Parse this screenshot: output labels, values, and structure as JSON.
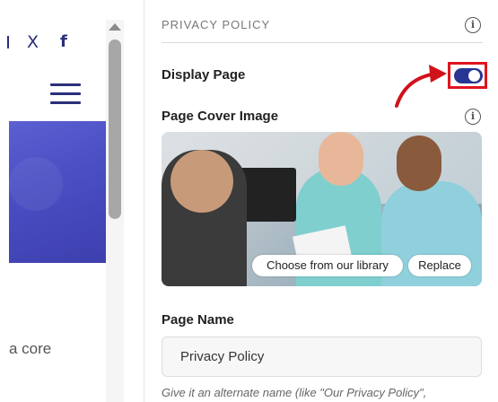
{
  "preview": {
    "social": {
      "x_icon": "X",
      "f_icon": "f"
    },
    "hamburger_icon": "menu-icon",
    "body_text": "a core"
  },
  "panel": {
    "section_title": "PRIVACY POLICY",
    "display_page_label": "Display Page",
    "display_page_enabled": true,
    "cover_image_label": "Page Cover Image",
    "choose_button": "Choose from our library",
    "replace_button": "Replace",
    "page_name_label": "Page Name",
    "page_name_value": "Privacy Policy",
    "hint": "Give it an alternate name (like \"Our Privacy Policy\","
  },
  "colors": {
    "accent": "#283593",
    "highlight": "#e0141e",
    "hero": "#4b4fc4"
  }
}
